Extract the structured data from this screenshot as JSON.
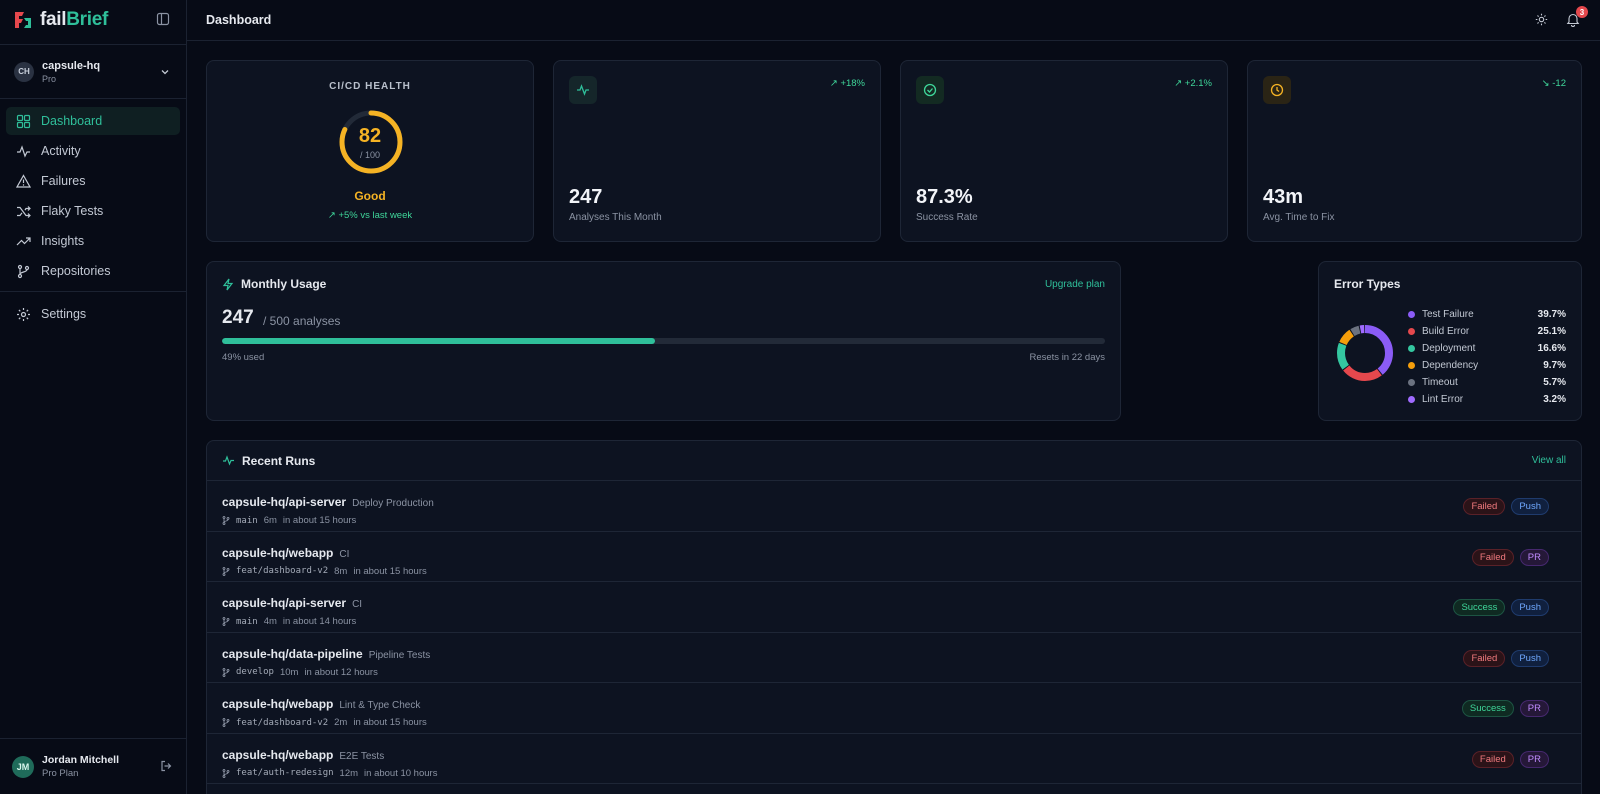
{
  "app": {
    "brand_a": "fail",
    "brand_b": "Brief"
  },
  "org": {
    "initials": "CH",
    "name": "capsule-hq",
    "plan": "Pro"
  },
  "nav": [
    {
      "label": "Dashboard",
      "icon": "dashboard-icon"
    },
    {
      "label": "Activity",
      "icon": "activity-icon"
    },
    {
      "label": "Failures",
      "icon": "warning-icon"
    },
    {
      "label": "Flaky Tests",
      "icon": "shuffle-icon"
    },
    {
      "label": "Insights",
      "icon": "trending-icon"
    },
    {
      "label": "Repositories",
      "icon": "git-branch-icon"
    }
  ],
  "settings": {
    "label": "Settings"
  },
  "user": {
    "initials": "JM",
    "name": "Jordan Mitchell",
    "plan": "Pro Plan"
  },
  "header": {
    "title": "Dashboard",
    "notifications": "3"
  },
  "health": {
    "title": "CI/CD HEALTH",
    "score": "82",
    "max": "/ 100",
    "score_fraction": 0.82,
    "status": "Good",
    "trend": "+5% vs last week"
  },
  "stats": [
    {
      "value": "247",
      "label": "Analyses This Month",
      "change": "+18%",
      "icon": "pulse-icon",
      "color": "#2fbf9a"
    },
    {
      "value": "87.3%",
      "label": "Success Rate",
      "change": "+2.1%",
      "icon": "check-circle-icon",
      "color": "#3fd69a"
    },
    {
      "value": "43m",
      "label": "Avg. Time to Fix",
      "change": "-12",
      "icon": "clock-icon",
      "color": "#f5b324"
    }
  ],
  "usage": {
    "title": "Monthly Usage",
    "upgrade": "Upgrade plan",
    "used": "247",
    "of": "/ 500 analyses",
    "used_pct": "49% used",
    "fraction": 0.49,
    "resets": "Resets in 22 days"
  },
  "errors": {
    "title": "Error Types",
    "items": [
      {
        "label": "Test Failure",
        "pct": "39.7%",
        "value": 39.7,
        "color": "#8b5cf6"
      },
      {
        "label": "Build Error",
        "pct": "25.1%",
        "value": 25.1,
        "color": "#e5484d"
      },
      {
        "label": "Deployment",
        "pct": "16.6%",
        "value": 16.6,
        "color": "#34c7a0"
      },
      {
        "label": "Dependency",
        "pct": "9.7%",
        "value": 9.7,
        "color": "#f59e0b"
      },
      {
        "label": "Timeout",
        "pct": "5.7%",
        "value": 5.7,
        "color": "#6b7280"
      },
      {
        "label": "Lint Error",
        "pct": "3.2%",
        "value": 3.2,
        "color": "#a06bff"
      }
    ]
  },
  "runs": {
    "title": "Recent Runs",
    "view_all": "View all",
    "items": [
      {
        "repo": "capsule-hq/api-server",
        "workflow": "Deploy Production",
        "branch": "main",
        "duration": "6m",
        "when": "in about 15 hours",
        "status": "Failed",
        "trigger": "Push"
      },
      {
        "repo": "capsule-hq/webapp",
        "workflow": "CI",
        "branch": "feat/dashboard-v2",
        "duration": "8m",
        "when": "in about 15 hours",
        "status": "Failed",
        "trigger": "PR"
      },
      {
        "repo": "capsule-hq/api-server",
        "workflow": "CI",
        "branch": "main",
        "duration": "4m",
        "when": "in about 14 hours",
        "status": "Success",
        "trigger": "Push"
      },
      {
        "repo": "capsule-hq/data-pipeline",
        "workflow": "Pipeline Tests",
        "branch": "develop",
        "duration": "10m",
        "when": "in about 12 hours",
        "status": "Failed",
        "trigger": "Push"
      },
      {
        "repo": "capsule-hq/webapp",
        "workflow": "Lint & Type Check",
        "branch": "feat/dashboard-v2",
        "duration": "2m",
        "when": "in about 15 hours",
        "status": "Success",
        "trigger": "PR"
      },
      {
        "repo": "capsule-hq/webapp",
        "workflow": "E2E Tests",
        "branch": "feat/auth-redesign",
        "duration": "12m",
        "when": "in about 10 hours",
        "status": "Failed",
        "trigger": "PR"
      }
    ]
  }
}
